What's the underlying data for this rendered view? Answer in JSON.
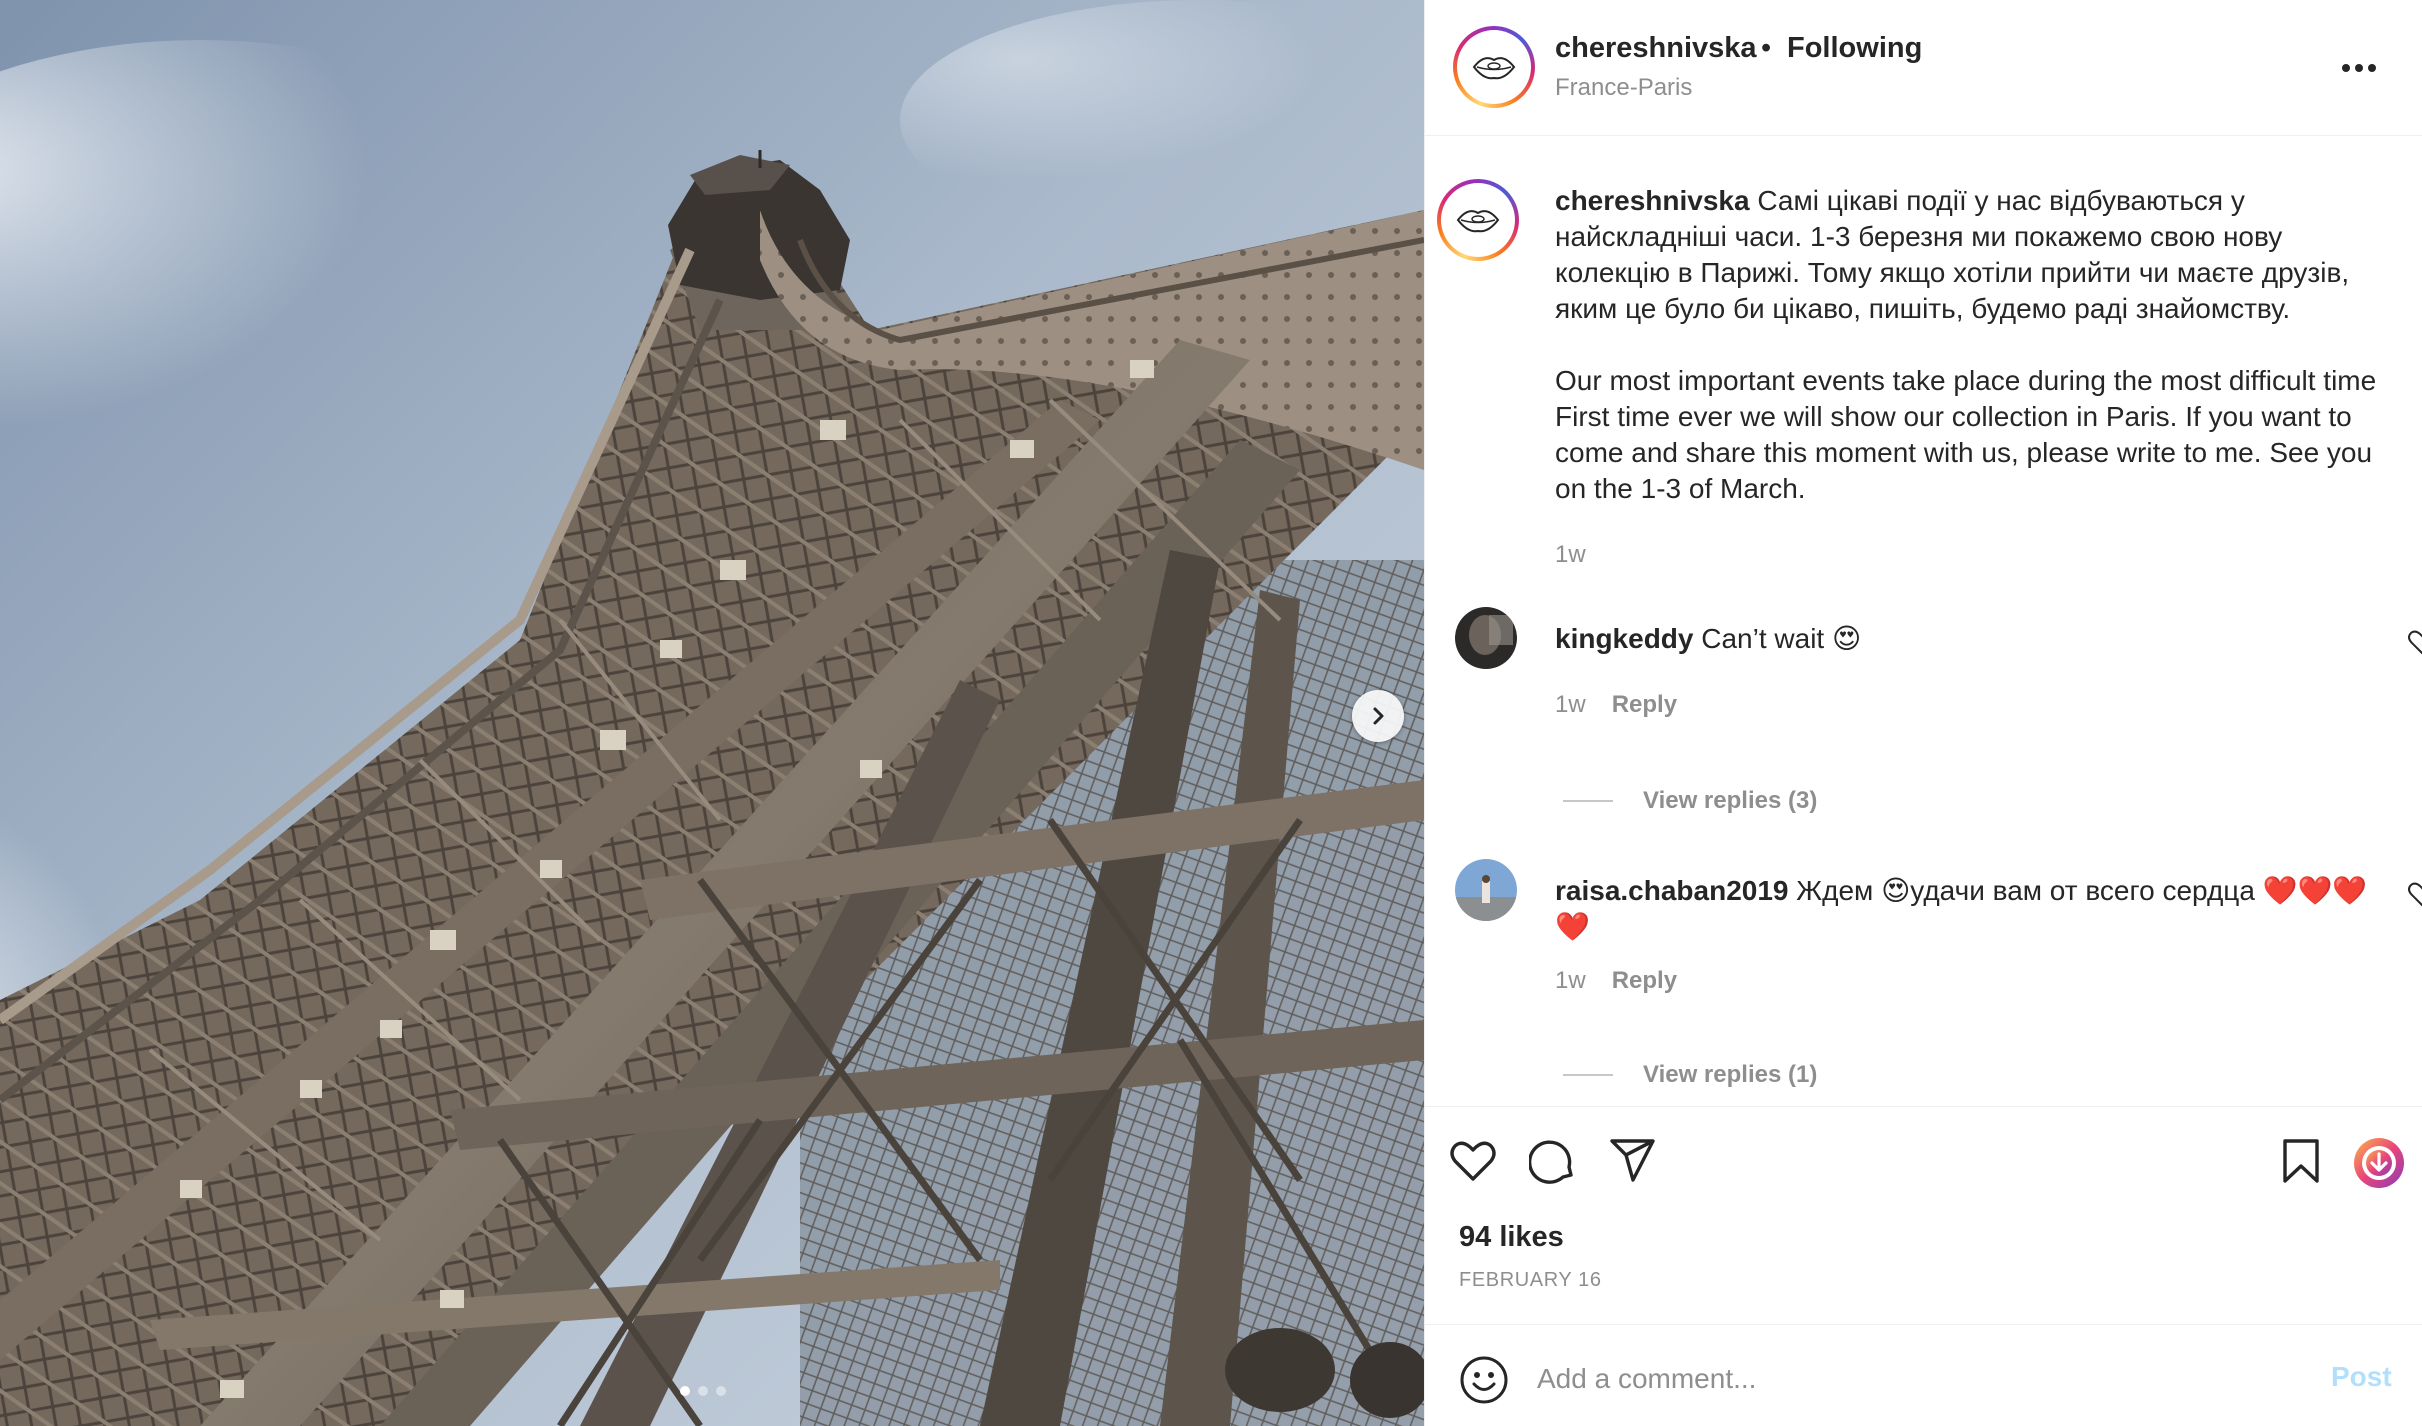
{
  "post": {
    "username": "chereshnivska",
    "separator": "•",
    "follow_status": "Following",
    "location": "France-Paris",
    "more_icon": "more-horizontal-icon"
  },
  "caption": {
    "username": "chereshnivska",
    "uk_lines": [
      "Самі цікаві події у нас відбуваються у",
      "найскладніші часи. 1-3 березня ми покажемо свою нову",
      "колекцію в Парижі. Тому якщо хотіли прийти чи маєте друзів,",
      "яким це було би цікаво, пишіть, будемо раді знайомству."
    ],
    "en_lines": [
      "Our most important events take place during the most difficult time",
      "First time ever we will show our collection in Paris. If you want to",
      "come and share this moment with us, please write to me. See you",
      "on the 1-3 of March."
    ],
    "time": "1w"
  },
  "comments": [
    {
      "username": "kingkeddy",
      "text": "Can’t wait 😍",
      "time": "1w",
      "reply_label": "Reply",
      "view_replies": "View replies (3)"
    },
    {
      "username": "raisa.chaban2019",
      "text": "Ждем 😍удачи вам от всего сердца ❤️❤️❤️",
      "text_line2": "❤️",
      "time": "1w",
      "reply_label": "Reply",
      "view_replies": "View replies (1)"
    }
  ],
  "actions": {
    "like_icon": "heart-icon",
    "comment_icon": "comment-icon",
    "share_icon": "send-icon",
    "save_icon": "bookmark-icon",
    "download_icon": "download-icon",
    "likes": "94 likes",
    "date": "FEBRUARY 16"
  },
  "add_comment": {
    "placeholder": "Add a comment...",
    "post_label": "Post"
  },
  "carousel": {
    "slide_count": 3,
    "active_index": 0
  },
  "colors": {
    "text": "#262626",
    "muted": "#8e8e8e",
    "post_disabled": "#b2dffc",
    "border": "#efefef"
  }
}
